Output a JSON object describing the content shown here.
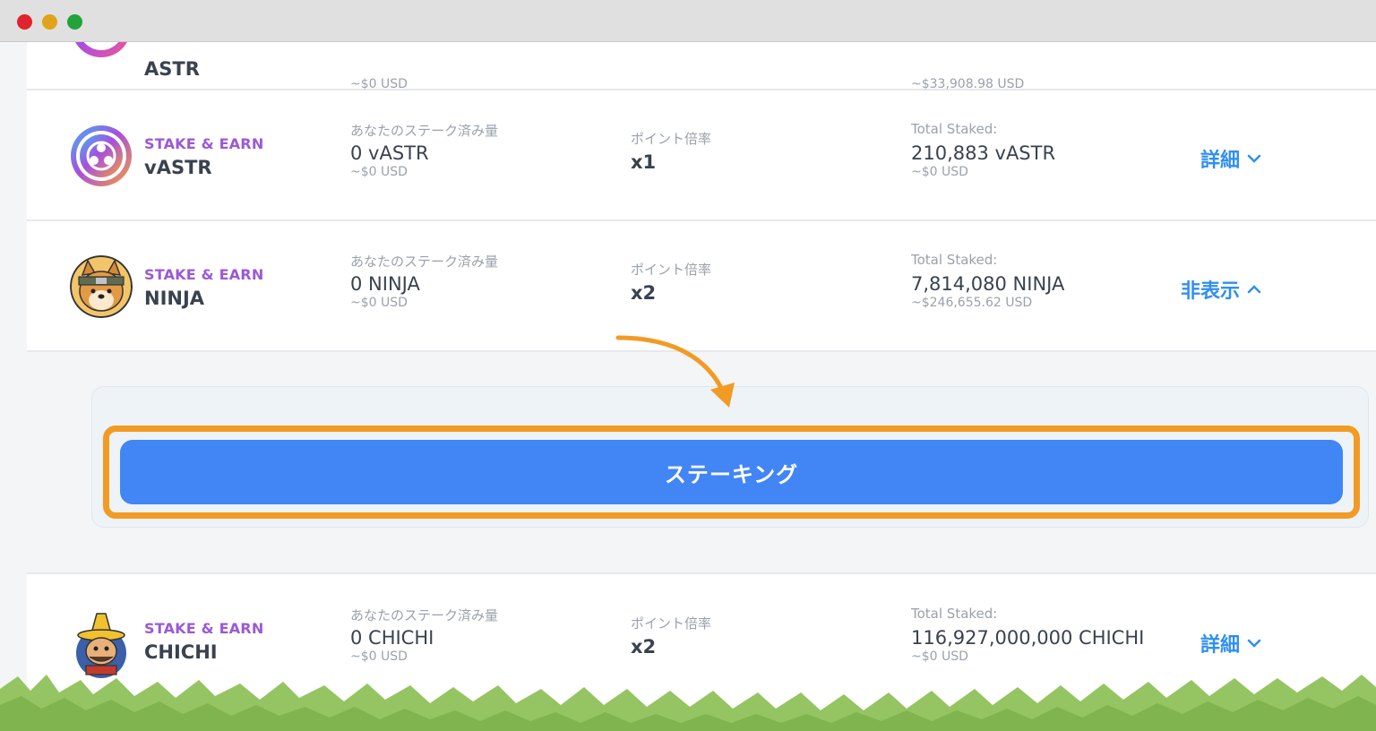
{
  "rows": [
    {
      "id": "astr",
      "name": "ASTR",
      "staked_sub": "~$0 USD",
      "total_sub": "~$33,908.98 USD"
    },
    {
      "id": "vastr",
      "tag": "STAKE & EARN",
      "name": "vASTR",
      "staked_label": "あなたのステーク済み量",
      "staked_value": "0 vASTR",
      "staked_sub": "~$0 USD",
      "mult_label": "ポイント倍率",
      "mult_value": "x1",
      "total_label": "Total Staked:",
      "total_value": "210,883 vASTR",
      "total_sub": "~$0 USD",
      "toggle": "詳細",
      "icon": "vastr-logo-icon"
    },
    {
      "id": "ninja",
      "tag": "STAKE & EARN",
      "name": "NINJA",
      "staked_label": "あなたのステーク済み量",
      "staked_value": "0 NINJA",
      "staked_sub": "~$0 USD",
      "mult_label": "ポイント倍率",
      "mult_value": "x2",
      "total_label": "Total Staked:",
      "total_value": "7,814,080 NINJA",
      "total_sub": "~$246,655.62 USD",
      "toggle": "非表示",
      "icon": "ninja-dog-icon"
    },
    {
      "id": "chichi",
      "tag": "STAKE & EARN",
      "name": "CHICHI",
      "staked_label": "あなたのステーク済み量",
      "staked_value": "0 CHICHI",
      "staked_sub": "~$0 USD",
      "mult_label": "ポイント倍率",
      "mult_value": "x2",
      "total_label": "Total Staked:",
      "total_value": "116,927,000,000 CHICHI",
      "total_sub": "~$0 USD",
      "toggle": "詳細",
      "icon": "chichi-character-icon"
    }
  ],
  "expanded": {
    "stake_button": "ステーキング"
  },
  "colors": {
    "accent": "#4285f4",
    "highlight": "#f29b24",
    "tag": "#9b59d6",
    "link": "#2f8ff0"
  }
}
